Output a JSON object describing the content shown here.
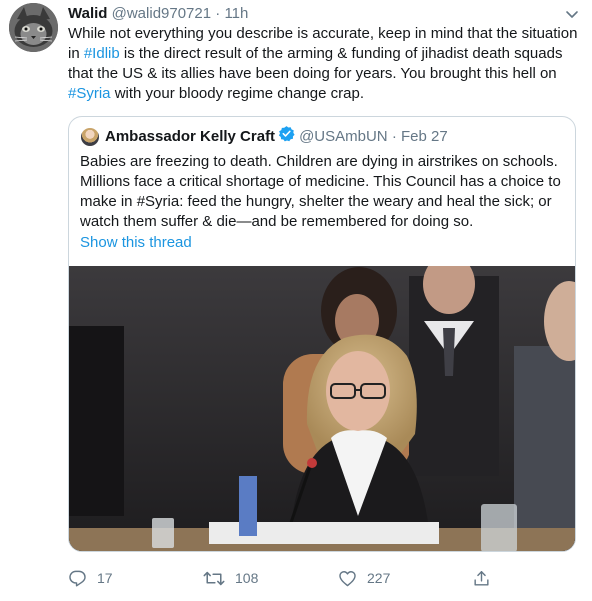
{
  "tweet": {
    "author": {
      "name": "Walid",
      "handle": "@walid970721"
    },
    "separator": "·",
    "time": "11h",
    "text_parts": [
      "While not everything you describe is accurate, keep in mind that the situation in ",
      "#Idlib",
      " is the direct result of the arming & funding of jihadist death squads that the US & its allies have been doing for years. You brought this hell on ",
      "#Syria",
      " with your bloody regime change crap."
    ],
    "icons": {
      "more": "chevron-down-icon"
    }
  },
  "quoted": {
    "author": {
      "name": "Ambassador Kelly Craft",
      "handle": "@USAmbUN"
    },
    "separator": "·",
    "date": "Feb 27",
    "text": "Babies are freezing to death. Children are dying in airstrikes on schools. Millions face a critical shortage of medicine. This Council has a choice to make in #Syria: feed the hungry, shelter the weary and heal the sick; or watch them suffer & die—and be remembered for doing so.",
    "show_thread": "Show this thread",
    "verified_icon": "verified-badge-icon"
  },
  "actions": {
    "replies": "17",
    "retweets": "108",
    "likes": "227"
  },
  "colors": {
    "link": "#1b95e0",
    "text": "#14171a",
    "muted": "#657786",
    "border": "#ccd6dd"
  }
}
